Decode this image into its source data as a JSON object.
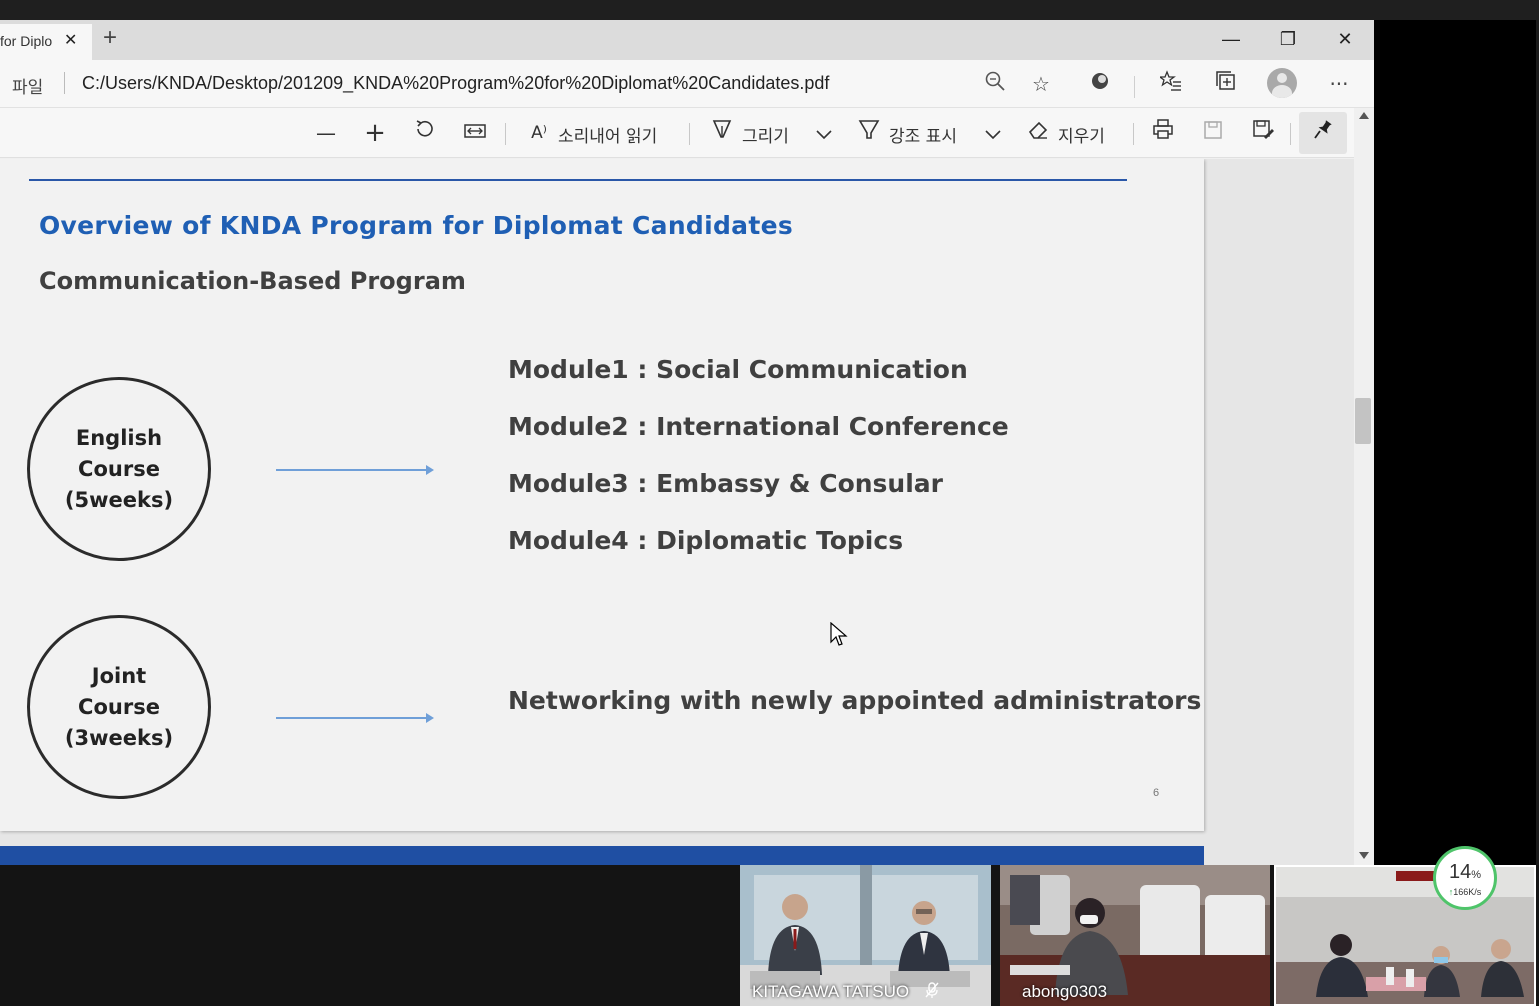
{
  "browser": {
    "tab_title": "for Diplo",
    "tab_close": "✕",
    "new_tab": "+",
    "win_minimize": "—",
    "win_restore": "❐",
    "win_close": "✕",
    "site_label": "파일",
    "url": "C:/Users/KNDA/Desktop/201209_KNDA%20Program%20for%20Diplomat%20Candidates.pdf",
    "more": "···"
  },
  "pdf_toolbar": {
    "read_aloud": "소리내어 읽기",
    "draw": "그리기",
    "highlight": "강조 표시",
    "erase": "지우기"
  },
  "slide": {
    "title": "Overview of KNDA Program for Diplomat Candidates",
    "subtitle": "Communication-Based Program",
    "english_course": [
      "English",
      "Course",
      "(5weeks)"
    ],
    "joint_course": [
      "Joint",
      "Course",
      "(3weeks)"
    ],
    "modules": [
      "Module1 : Social Communication",
      "Module2 : International Conference",
      "Module3 : Embassy & Consular",
      "Module4 : Diplomatic Topics"
    ],
    "networking": "Networking with newly appointed administrators",
    "page_number": "6"
  },
  "video": {
    "participant_1": "KITAGAWA TATSUO",
    "participant_2": "abong0303"
  },
  "network_widget": {
    "percent": "14",
    "percent_unit": "%",
    "rate": "166K/s",
    "rate_arrow": "↑"
  },
  "colors": {
    "title_blue": "#1f5fb4",
    "rule_blue": "#2a57a8",
    "arrow_blue": "#6f9fd8",
    "footer_blue": "#1f4fa3"
  }
}
